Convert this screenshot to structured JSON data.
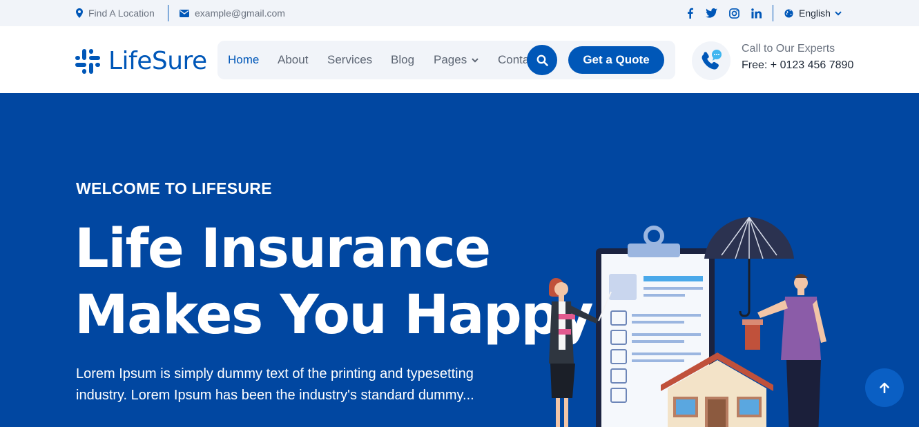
{
  "topbar": {
    "location": "Find A Location",
    "email": "example@gmail.com",
    "social": [
      "facebook-icon",
      "twitter-icon",
      "instagram-icon",
      "linkedin-icon"
    ],
    "language": "English"
  },
  "header": {
    "logo_text": "LifeSure",
    "nav": [
      {
        "label": "Home",
        "active": true
      },
      {
        "label": "About"
      },
      {
        "label": "Services"
      },
      {
        "label": "Blog"
      },
      {
        "label": "Pages",
        "dropdown": true
      },
      {
        "label": "Contact"
      }
    ],
    "quote_button": "Get a Quote",
    "call_label": "Call to Our Experts",
    "call_number": "Free: + 0123 456 7890"
  },
  "hero": {
    "eyebrow": "WELCOME TO LIFESURE",
    "title_line1": "Life Insurance",
    "title_line2": "Makes You Happy",
    "description": "Lorem Ipsum is simply dummy text of the printing and typesetting industry. Lorem Ipsum has been the industry's standard dummy..."
  },
  "colors": {
    "primary": "#0057b8",
    "hero_bg": "#0147a1",
    "topbar_bg": "#f1f4f9"
  }
}
